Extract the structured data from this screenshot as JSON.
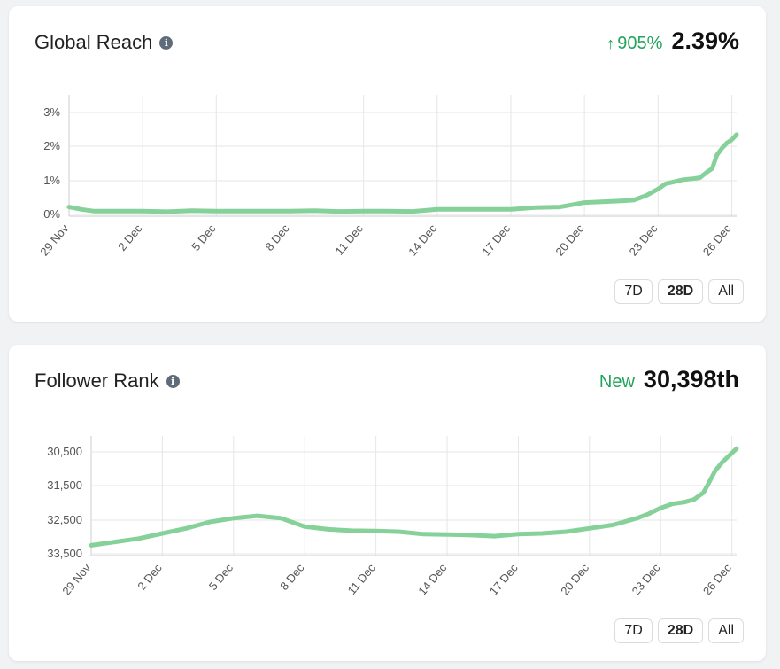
{
  "cards": [
    {
      "title": "Global Reach",
      "info_icon": "info-icon",
      "change_arrow": "↑",
      "change_text": "905%",
      "value": "2.39%",
      "range_buttons": [
        "7D",
        "28D",
        "All"
      ],
      "active_range": "28D"
    },
    {
      "title": "Follower Rank",
      "info_icon": "info-icon",
      "change_text": "New",
      "value": "30,398th",
      "range_buttons": [
        "7D",
        "28D",
        "All"
      ],
      "active_range": "28D"
    }
  ],
  "colors": {
    "line": "#86d199",
    "positive": "#22a35a",
    "grid": "#e6e6e6"
  },
  "chart_data": [
    {
      "type": "line",
      "title": "Global Reach",
      "x_ticks": [
        "29 Nov",
        "2 Dec",
        "5 Dec",
        "8 Dec",
        "11 Dec",
        "14 Dec",
        "17 Dec",
        "20 Dec",
        "23 Dec",
        "26 Dec"
      ],
      "y_ticks": [
        "0%",
        "1%",
        "2%",
        "3%"
      ],
      "ylim": [
        0,
        3.2
      ],
      "y_unit": "%",
      "grid": true,
      "series": [
        {
          "x": [
            0,
            0.5,
            1,
            2,
            3,
            4,
            5,
            6,
            7,
            8,
            9,
            10,
            11,
            12,
            13,
            14,
            15,
            16,
            17,
            18,
            19,
            20,
            21,
            22,
            22.5,
            23,
            23.5,
            24,
            24.3,
            24.6,
            25,
            25.4,
            25.7,
            26,
            26.2,
            26.4,
            26.6,
            26.8,
            27,
            27.2
          ],
          "y": [
            0.22,
            0.15,
            0.1,
            0.1,
            0.1,
            0.08,
            0.11,
            0.1,
            0.1,
            0.1,
            0.1,
            0.11,
            0.09,
            0.1,
            0.1,
            0.09,
            0.15,
            0.15,
            0.15,
            0.15,
            0.2,
            0.22,
            0.35,
            0.38,
            0.4,
            0.42,
            0.55,
            0.75,
            0.9,
            0.95,
            1.02,
            1.05,
            1.08,
            1.25,
            1.35,
            1.75,
            1.95,
            2.1,
            2.2,
            2.35
          ]
        }
      ]
    },
    {
      "type": "line",
      "title": "Follower Rank",
      "x_ticks": [
        "29 Nov",
        "2 Dec",
        "5 Dec",
        "8 Dec",
        "11 Dec",
        "14 Dec",
        "17 Dec",
        "20 Dec",
        "23 Dec",
        "26 Dec"
      ],
      "y_ticks": [
        "30,500",
        "31,500",
        "32,500",
        "33,500"
      ],
      "y_inverted": true,
      "ylim": [
        33500,
        30000
      ],
      "grid": true,
      "series": [
        {
          "x": [
            0,
            1,
            2,
            3,
            4,
            5,
            6,
            7,
            8,
            9,
            10,
            11,
            12,
            13,
            14,
            15,
            16,
            17,
            18,
            19,
            20,
            21,
            22,
            23,
            23.5,
            24,
            24.5,
            25,
            25.4,
            25.8,
            26,
            26.3,
            26.6,
            26.9,
            27.2
          ],
          "y": [
            33250,
            33150,
            33050,
            32900,
            32750,
            32560,
            32450,
            32380,
            32450,
            32700,
            32780,
            32820,
            32830,
            32850,
            32920,
            32930,
            32950,
            32980,
            32920,
            32900,
            32850,
            32750,
            32650,
            32450,
            32320,
            32150,
            32030,
            31980,
            31900,
            31700,
            31450,
            31050,
            30800,
            30600,
            30400
          ]
        }
      ]
    }
  ]
}
